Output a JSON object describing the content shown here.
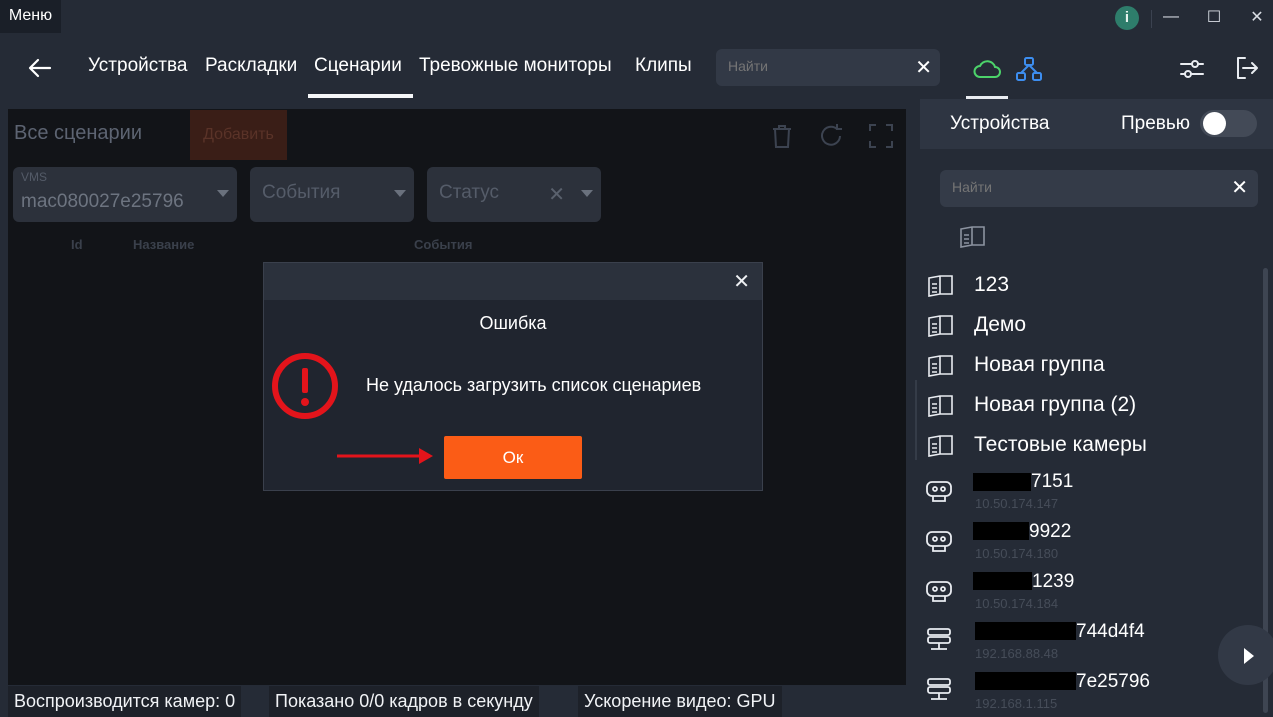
{
  "titlebar": {
    "menu_label": "Меню",
    "info_icon": "info-icon",
    "minimize": "—",
    "maximize": "☐",
    "close": "✕"
  },
  "nav": {
    "tabs": [
      "Устройства",
      "Раскладки",
      "Сценарии",
      "Тревожные мониторы",
      "Клипы"
    ],
    "active_tab": "Сценарии",
    "search_placeholder": "Найти",
    "search_clear": "✕"
  },
  "scenarios": {
    "title": "Все сценарии",
    "add_label": "Добавить",
    "filters": {
      "vms_label": "VMS",
      "vms_value": "mac080027e25796",
      "events_placeholder": "События",
      "status_placeholder": "Статус"
    },
    "columns": [
      "Id",
      "Название",
      "События"
    ]
  },
  "dialog": {
    "close": "✕",
    "title": "Ошибка",
    "message": "Не удалось загрузить список сценариев",
    "ok_label": "Ок"
  },
  "status_bar": {
    "playing": "Воспроизводится камер: 0",
    "fps": "Показано 0/0 кадров в секунду",
    "accel": "Ускорение видео: GPU"
  },
  "right_panel": {
    "title": "Устройства",
    "preview_label": "Превью",
    "preview_enabled": false,
    "search_placeholder": "Найти",
    "search_clear": "✕",
    "groups": [
      "123",
      "Демо",
      "Новая группа",
      "Новая группа (2)",
      "Тестовые камеры"
    ],
    "devices": [
      {
        "suffix": "7151",
        "ip": "10.50.174.147",
        "icon": "camera-icon"
      },
      {
        "suffix": "9922",
        "ip": "10.50.174.180",
        "icon": "camera-icon"
      },
      {
        "suffix": "1239",
        "ip": "10.50.174.184",
        "icon": "camera-icon"
      },
      {
        "suffix": "744d4f4",
        "ip": "192.168.88.48",
        "icon": "server-icon"
      },
      {
        "suffix": "7e25796",
        "ip": "192.168.1.115",
        "icon": "server-icon"
      }
    ]
  },
  "colors": {
    "accent": "#fb5c16",
    "error": "#e3141b",
    "cloud": "#4cd36a",
    "topology": "#3d8ef0"
  }
}
